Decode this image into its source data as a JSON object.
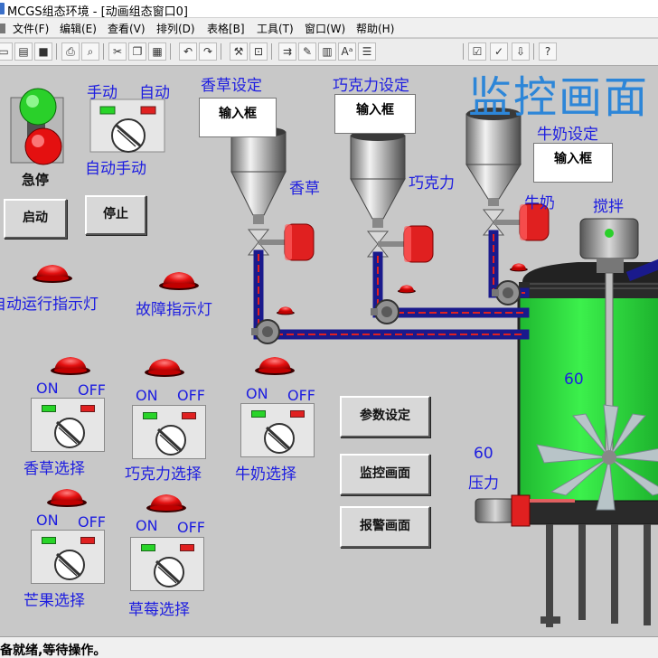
{
  "window": {
    "title": "MCGS组态环境 - [动画组态窗口0]"
  },
  "menu": [
    "文件(F)",
    "编辑(E)",
    "查看(V)",
    "排列(D)",
    "表格[B]",
    "工具(T)",
    "窗口(W)",
    "帮助(H)"
  ],
  "toolbar": [
    {
      "icon": "new-file-icon",
      "glyph": "▭"
    },
    {
      "icon": "open-icon",
      "glyph": "▤"
    },
    {
      "icon": "save-icon",
      "glyph": "■"
    },
    {
      "icon": "print-icon",
      "glyph": "⎙"
    },
    {
      "icon": "print-preview-icon",
      "glyph": "⌕"
    },
    {
      "icon": "cut-icon",
      "glyph": "✂"
    },
    {
      "icon": "copy-icon",
      "glyph": "❐"
    },
    {
      "icon": "paste-icon",
      "glyph": "▦"
    },
    {
      "icon": "undo-icon",
      "glyph": "↶"
    },
    {
      "icon": "redo-icon",
      "glyph": "↷"
    },
    {
      "icon": "tools-icon",
      "glyph": "⚒"
    },
    {
      "icon": "frame-icon",
      "glyph": "⊡"
    },
    {
      "icon": "align-icon",
      "glyph": "⇉"
    },
    {
      "icon": "edit-icon",
      "glyph": "✎"
    },
    {
      "icon": "table-icon",
      "glyph": "▥"
    },
    {
      "icon": "text-icon",
      "glyph": "Aᵃ"
    },
    {
      "icon": "list-icon",
      "glyph": "☰"
    },
    {
      "icon": "properties-icon",
      "glyph": "☑"
    },
    {
      "icon": "check-icon",
      "glyph": "✓"
    },
    {
      "icon": "download-icon",
      "glyph": "⇩"
    },
    {
      "icon": "help-icon",
      "glyph": "?"
    }
  ],
  "screen": {
    "title": "监控画面",
    "manual": "手动",
    "auto": "自动",
    "auto_manual": "自动手动",
    "estop": "急停",
    "start": "启动",
    "stop": "停止",
    "auto_run_lamp": "自动运行指示灯",
    "fault_lamp": "故障指示灯",
    "vanilla_setting": "香草设定",
    "chocolate_setting": "巧克力设定",
    "milk_setting": "牛奶设定",
    "input_box": "输入框",
    "vanilla": "香草",
    "chocolate": "巧克力",
    "milk": "牛奶",
    "mixer": "搅拌",
    "level_value": "60",
    "pressure_value": "60",
    "pressure": "压力",
    "on": "ON",
    "off": "OFF",
    "vanilla_select": "香草选择",
    "chocolate_select": "巧克力选择",
    "milk_select": "牛奶选择",
    "mango_select": "芒果选择",
    "strawberry_select": "草莓选择",
    "param_setting": "参数设定",
    "monitor_screen": "监控画面",
    "alarm_screen": "报警画面"
  },
  "status": "准备就绪,等待操作。",
  "colors": {
    "pipe_blue": "#1a1a8c",
    "pipe_red": "#e02020",
    "tank_green": "#22e03a",
    "label_blue": "#1d1de0",
    "title_blue": "#2d86d8",
    "lamp_red": "#e41010"
  }
}
